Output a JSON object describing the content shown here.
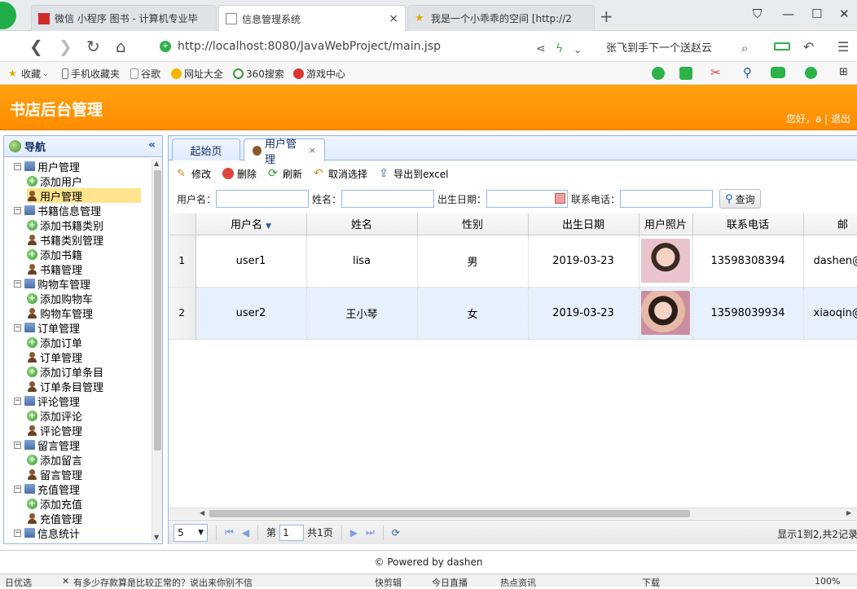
{
  "browser": {
    "tabs": [
      {
        "label": "微信 小程序 图书 - 计算机专业毕",
        "active": false
      },
      {
        "label": "信息管理系统",
        "active": true
      },
      {
        "label": "我是一个小乖乖的空间 [http://2",
        "active": false
      }
    ],
    "url": "http://localhost:8080/JavaWebProject/main.jsp",
    "search_text": "张飞到手下一个送赵云",
    "bookmarks": [
      "收藏",
      "手机收藏夹",
      "谷歌",
      "网址大全",
      "360搜索",
      "游戏中心"
    ]
  },
  "app": {
    "title": "书店后台管理",
    "welcome": "您好，a | 退出"
  },
  "sidebar": {
    "title": "导航",
    "collapse_icon": "«",
    "tree": [
      {
        "label": "用户管理",
        "type": "group"
      },
      {
        "label": "添加用户",
        "type": "add"
      },
      {
        "label": "用户管理",
        "type": "manage",
        "selected": true
      },
      {
        "label": "书籍信息管理",
        "type": "group"
      },
      {
        "label": "添加书籍类别",
        "type": "add"
      },
      {
        "label": "书籍类别管理",
        "type": "manage"
      },
      {
        "label": "添加书籍",
        "type": "add"
      },
      {
        "label": "书籍管理",
        "type": "manage"
      },
      {
        "label": "购物车管理",
        "type": "group"
      },
      {
        "label": "添加购物车",
        "type": "add"
      },
      {
        "label": "购物车管理",
        "type": "manage"
      },
      {
        "label": "订单管理",
        "type": "group"
      },
      {
        "label": "添加订单",
        "type": "add"
      },
      {
        "label": "订单管理",
        "type": "manage"
      },
      {
        "label": "添加订单条目",
        "type": "add"
      },
      {
        "label": "订单条目管理",
        "type": "manage"
      },
      {
        "label": "评论管理",
        "type": "group"
      },
      {
        "label": "添加评论",
        "type": "add"
      },
      {
        "label": "评论管理",
        "type": "manage"
      },
      {
        "label": "留言管理",
        "type": "group"
      },
      {
        "label": "添加留言",
        "type": "add"
      },
      {
        "label": "留言管理",
        "type": "manage"
      },
      {
        "label": "充值管理",
        "type": "group"
      },
      {
        "label": "添加充值",
        "type": "add"
      },
      {
        "label": "充值管理",
        "type": "manage"
      },
      {
        "label": "信息统计",
        "type": "group"
      }
    ]
  },
  "panel_tabs": [
    {
      "label": "起始页",
      "active": false
    },
    {
      "label": "用户管理",
      "active": true,
      "close": "×"
    }
  ],
  "toolbar": {
    "edit": "修改",
    "delete": "删除",
    "refresh": "刷新",
    "deselect": "取消选择",
    "export": "导出到excel"
  },
  "search": {
    "username_label": "用户名：",
    "name_label": "姓名：",
    "birthday_label": "出生日期：",
    "phone_label": "联系电话：",
    "query_label": "查询"
  },
  "grid": {
    "columns": [
      "用户名",
      "姓名",
      "性别",
      "出生日期",
      "用户照片",
      "联系电话",
      "邮"
    ],
    "rows": [
      {
        "rownum": "1",
        "username": "user1",
        "name": "lisa",
        "gender": "男",
        "birthday": "2019-03-23",
        "phone": "13598308394",
        "email": "dashen@"
      },
      {
        "rownum": "2",
        "username": "user2",
        "name": "王小琴",
        "gender": "女",
        "birthday": "2019-03-23",
        "phone": "13598039934",
        "email": "xiaoqin@"
      }
    ]
  },
  "pager": {
    "page_size": "5",
    "page_prefix": "第",
    "page_value": "1",
    "page_total": "共1页",
    "info": "显示1到2,共2记录"
  },
  "footer": "© Powered by dashen",
  "statusbar": {
    "left": "日优选",
    "news": "有多少存款算是比较正常的？说出来你别不信",
    "items": [
      "快剪辑",
      "今日直播",
      "热点资讯",
      "下载",
      "100%"
    ]
  },
  "colors": {
    "header_orange": "#ff9a00",
    "panel_border": "#95b8e7",
    "selected_tree": "#ffe48d",
    "row_alt": "#e7f0fd"
  }
}
